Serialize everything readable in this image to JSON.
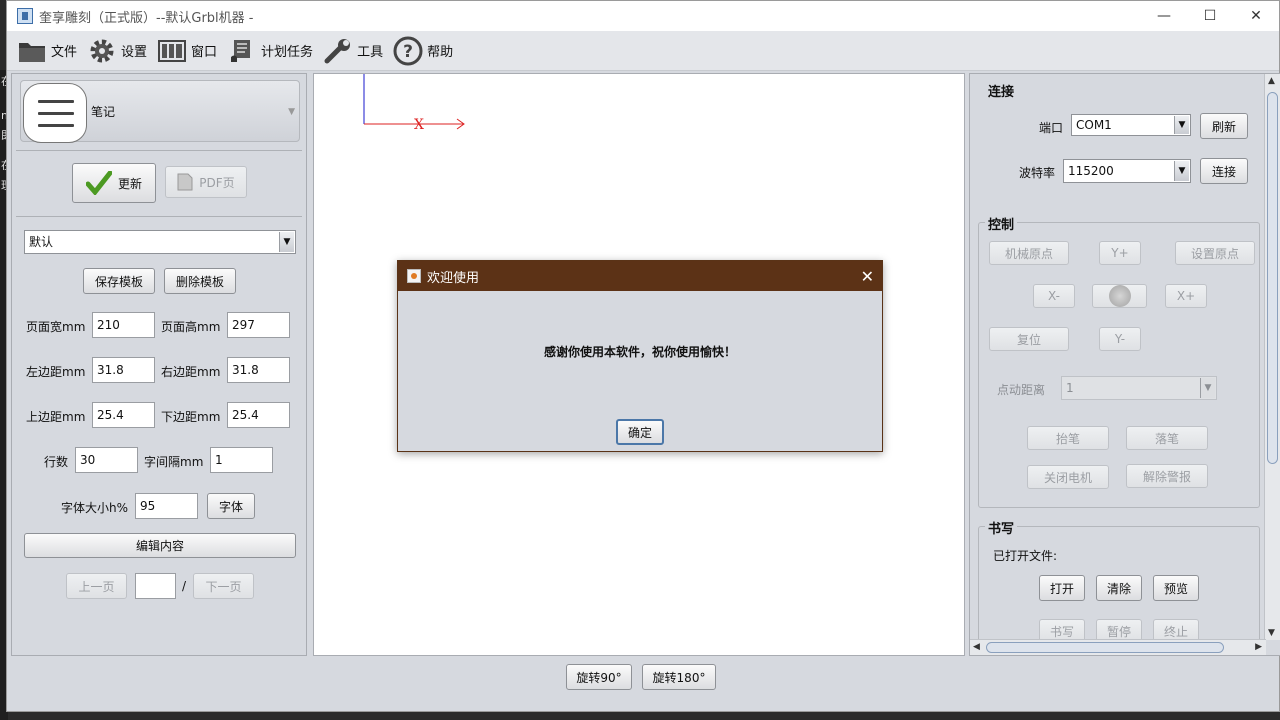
{
  "window": {
    "title": "奎享雕刻（正式版）--默认Grbl机器 -",
    "controls": {
      "minimize": "—",
      "maximize": "☐",
      "close": "✕"
    }
  },
  "background_strip": [
    "在",
    "m",
    "即",
    "在",
    "理"
  ],
  "toolbar": {
    "items": [
      {
        "label": "文件",
        "icon": "folder-icon"
      },
      {
        "label": "设置",
        "icon": "gear-icon"
      },
      {
        "label": "窗口",
        "icon": "window-icon"
      },
      {
        "label": "计划任务",
        "icon": "scroll-icon"
      },
      {
        "label": "工具",
        "icon": "wrench-icon"
      },
      {
        "label": "帮助",
        "icon": "help-icon"
      }
    ]
  },
  "left": {
    "notes_label": "笔记",
    "update_button": "更新",
    "pdf_button": "PDF页",
    "template_value": "默认",
    "save_template": "保存模板",
    "delete_template": "删除模板",
    "page_width_label": "页面宽mm",
    "page_width": "210",
    "page_height_label": "页面高mm",
    "page_height": "297",
    "left_margin_label": "左边距mm",
    "left_margin": "31.8",
    "right_margin_label": "右边距mm",
    "right_margin": "31.8",
    "top_margin_label": "上边距mm",
    "top_margin": "25.4",
    "bottom_margin_label": "下边距mm",
    "bottom_margin": "25.4",
    "rows_label": "行数",
    "rows": "30",
    "char_spacing_label": "字间隔mm",
    "char_spacing": "1",
    "font_size_label": "字体大小h%",
    "font_size": "95",
    "font_button": "字体",
    "edit_content": "编辑内容",
    "prev_page": "上一页",
    "page_sep": "/",
    "next_page": "下一页",
    "page_value": ""
  },
  "canvas": {
    "axis_x_label": "X"
  },
  "right": {
    "connect_title": "连接",
    "port_label": "端口",
    "port_value": "COM1",
    "refresh": "刷新",
    "baud_label": "波特率",
    "baud_value": "115200",
    "connect": "连接",
    "control_title": "控制",
    "machine_origin": "机械原点",
    "y_plus": "Y+",
    "set_origin": "设置原点",
    "x_minus": "X-",
    "x_plus": "X+",
    "reset": "复位",
    "y_minus": "Y-",
    "jog_distance_label": "点动距离",
    "jog_distance": "1",
    "pen_up": "抬笔",
    "pen_down": "落笔",
    "motor_off": "关闭电机",
    "clear_alarm": "解除警报",
    "write_title": "书写",
    "opened_file_label": "已打开文件:",
    "open": "打开",
    "clear": "清除",
    "preview": "预览",
    "write": "书写",
    "pause": "暂停",
    "stop": "终止"
  },
  "bottom": {
    "rotate90": "旋转90°",
    "rotate180": "旋转180°"
  },
  "dialog": {
    "title": "欢迎使用",
    "message": "感谢你使用本软件，祝你使用愉快！",
    "ok": "确定",
    "close": "✕"
  },
  "colors": {
    "dialog_title_bg": "#5c3216",
    "axis_y": "#1a1acc",
    "axis_x": "#dd2222"
  }
}
